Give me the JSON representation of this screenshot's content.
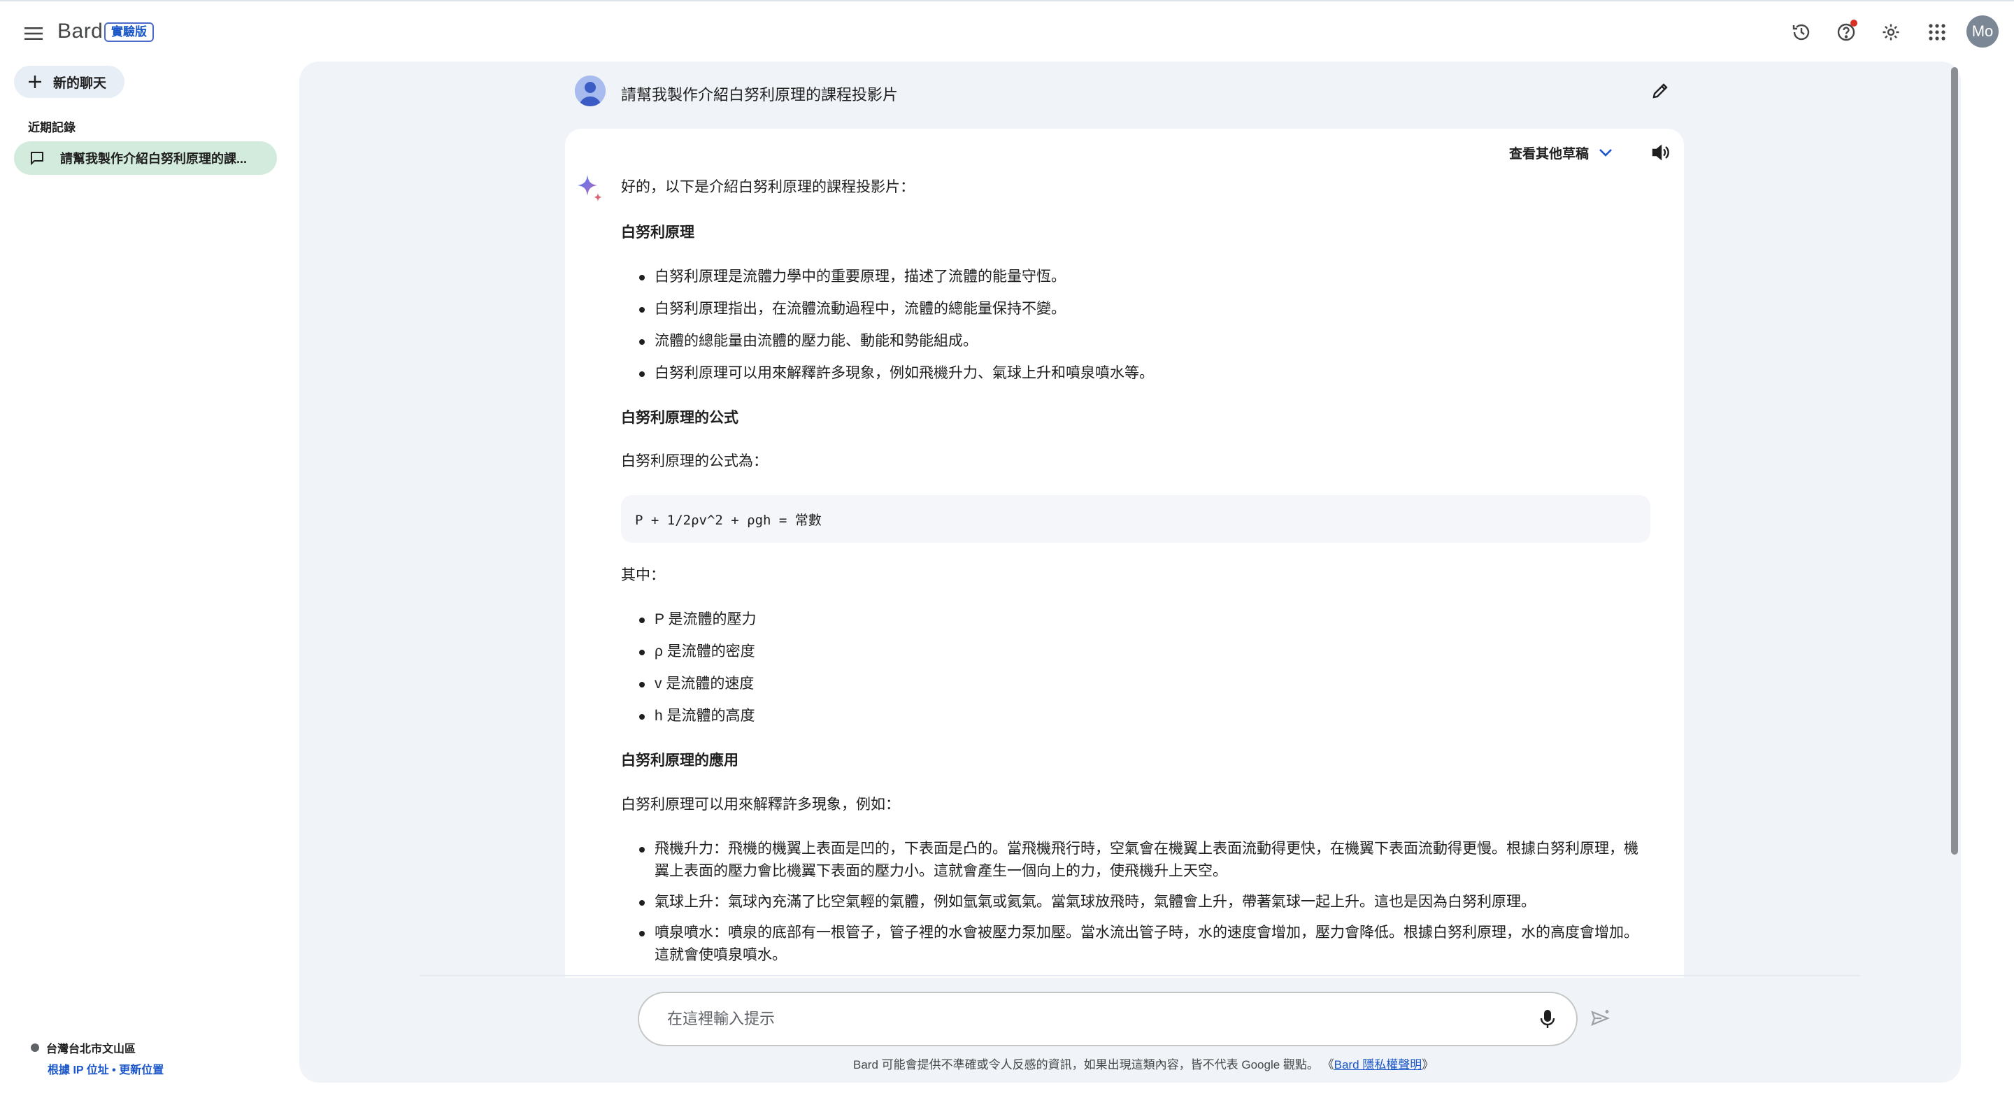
{
  "app": {
    "name": "Bard",
    "badge": "實驗版"
  },
  "sidebar": {
    "new_chat_label": "新的聊天",
    "recent_title": "近期記錄",
    "recent_items": [
      {
        "label": "請幫我製作介紹白努利原理的課..."
      }
    ],
    "location": {
      "place": "台灣台北市文山區",
      "source_link": "根據 IP 位址",
      "separator": " • ",
      "update_link": "更新位置"
    }
  },
  "conversation": {
    "user_prompt": "請幫我製作介紹白努利原理的課程投影片",
    "drafts_label": "查看其他草稿",
    "response": {
      "intro": "好的，以下是介紹白努利原理的課程投影片：",
      "section1_title": "白努利原理",
      "section1_bullets": [
        "白努利原理是流體力學中的重要原理，描述了流體的能量守恆。",
        "白努利原理指出，在流體流動過程中，流體的總能量保持不變。",
        "流體的總能量由流體的壓力能、動能和勢能組成。",
        "白努利原理可以用來解釋許多現象，例如飛機升力、氣球上升和噴泉噴水等。"
      ],
      "section2_title": "白努利原理的公式",
      "section2_text": "白努利原理的公式為：",
      "formula": "P + 1/2ρv^2 + ρgh = 常數",
      "where_label": "其中：",
      "where_bullets": [
        "P 是流體的壓力",
        "ρ 是流體的密度",
        "v 是流體的速度",
        "h 是流體的高度"
      ],
      "section3_title": "白努利原理的應用",
      "section3_text": "白努利原理可以用來解釋許多現象，例如：",
      "section3_bullets": [
        "飛機升力：飛機的機翼上表面是凹的，下表面是凸的。當飛機飛行時，空氣會在機翼上表面流動得更快，在機翼下表面流動得更慢。根據白努利原理，機翼上表面的壓力會比機翼下表面的壓力小。這就會產生一個向上的力，使飛機升上天空。",
        "氣球上升：氣球內充滿了比空氣輕的氣體，例如氫氣或氦氣。當氣球放飛時，氣體會上升，帶著氣球一起上升。這也是因為白努利原理。",
        "噴泉噴水：噴泉的底部有一根管子，管子裡的水會被壓力泵加壓。當水流出管子時，水的速度會增加，壓力會降低。根據白努利原理，水的高度會增加。這就會使噴泉噴水。"
      ]
    }
  },
  "input": {
    "placeholder": "在這裡輸入提示"
  },
  "footer": {
    "disclaimer": "Bard 可能會提供不準確或令人反感的資訊，如果出現這類內容，皆不代表 Google 觀點。",
    "privacy_open": " 《",
    "privacy_link": "Bard 隱私權聲明",
    "privacy_close": "》"
  },
  "user": {
    "avatar_initials": "Mo"
  },
  "colors": {
    "accent": "#1a56c8",
    "panel_bg": "#f0f4f9",
    "recent_active": "#d3ebdc",
    "notification": "#d93025"
  },
  "icons": {
    "menu": "menu-icon",
    "history": "history-icon",
    "help": "help-icon",
    "settings": "gear-icon",
    "apps": "apps-grid-icon",
    "edit": "pencil-icon",
    "speaker": "speaker-icon",
    "mic": "mic-icon",
    "send": "send-icon"
  }
}
